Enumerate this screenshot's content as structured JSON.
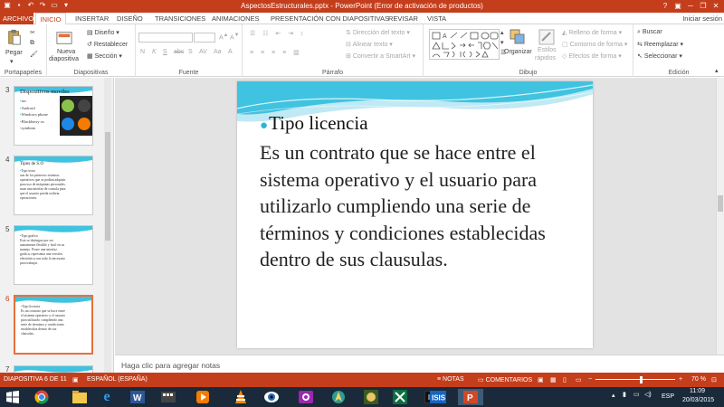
{
  "window": {
    "title": "AspectosEstructurales.pptx -  PowerPoint (Error de activación de productos)"
  },
  "tabs": [
    {
      "label": "ARCHIVO"
    },
    {
      "label": "INICIO"
    },
    {
      "label": "INSERTAR"
    },
    {
      "label": "DISEÑO"
    },
    {
      "label": "TRANSICIONES"
    },
    {
      "label": "ANIMACIONES"
    },
    {
      "label": "PRESENTACIÓN CON DIAPOSITIVAS"
    },
    {
      "label": "REVISAR"
    },
    {
      "label": "VISTA"
    }
  ],
  "signin": "Iniciar sesión",
  "ribbon": {
    "clipboard": {
      "paste": "Pegar",
      "group": "Portapapeles"
    },
    "slides": {
      "new_slide_1": "Nueva",
      "new_slide_2": "diapositiva",
      "layout": "Diseño",
      "reset": "Restablecer",
      "section": "Sección",
      "group": "Diapositivas"
    },
    "font": {
      "group": "Fuente",
      "buttons": [
        "N",
        "K",
        "S",
        "abc",
        "S",
        "AV",
        "Aa",
        "A"
      ]
    },
    "paragraph": {
      "direction": "Dirección del texto",
      "align": "Alinear texto",
      "smartart": "Convertir a SmartArt",
      "group": "Párrafo"
    },
    "drawing": {
      "arrange": "Organizar",
      "quick_styles_1": "Estilos",
      "quick_styles_2": "rápidos",
      "fill": "Relleno de forma",
      "outline": "Contorno de forma",
      "effects": "Efectos de forma",
      "group": "Dibujo"
    },
    "editing": {
      "find": "Buscar",
      "replace": "Reemplazar",
      "select": "Seleccionar",
      "group": "Edición"
    }
  },
  "thumbnails": [
    {
      "num": "3",
      "title": "Dispositivos moviles",
      "bullets": [
        "ios",
        "Android",
        "Windows phone",
        "Blackberry os",
        "symbian"
      ]
    },
    {
      "num": "4",
      "title": "Tipos de S.O",
      "lines": [
        "Tipo texto",
        "son de los primeros sistemas",
        "operativos que se podían adquirir",
        "para uso de máquinas personales.",
        "usan una interfaz de consola para",
        "que el usuario pueda realizar",
        "operaciones."
      ]
    },
    {
      "num": "5",
      "title": "Tipo grafico",
      "lines": [
        "Este se distingue por ser",
        "sumamente flexible y fácil en su",
        "manejo. Posee una interfaz",
        "grafica, representa una versión",
        "electrónica con todo lo necesario",
        "para trabajar."
      ]
    },
    {
      "num": "6",
      "title": "Tipo licencia",
      "lines": [
        "Es un contrato que se hace entre",
        "el sistema operativo y el usuario",
        "para utilizarlo cumpliendo una",
        "serie de términos y condiciones",
        "establecidas dentro de sus",
        "clausulas."
      ]
    },
    {
      "num": "7"
    }
  ],
  "slide": {
    "heading": "Tipo licencia",
    "body": "Es un contrato que se hace entre el sistema operativo y el usuario para utilizarlo cumpliendo una serie de términos y condiciones establecidas dentro de sus clausulas."
  },
  "notes_placeholder": "Haga clic para agregar notas",
  "status": {
    "slide_of": "DIAPOSITIVA 6 DE 11",
    "language": "ESPAÑOL (ESPAÑA)",
    "notes": "NOTAS",
    "comments": "COMENTARIOS",
    "zoom": "70 %"
  },
  "taskbar": {
    "lang": "ESP",
    "time": "11:09",
    "date": "20/03/2015"
  },
  "colors": {
    "accent": "#c43e1c",
    "bullet": "#2bb5d6",
    "wave": "#3fc3e0"
  }
}
